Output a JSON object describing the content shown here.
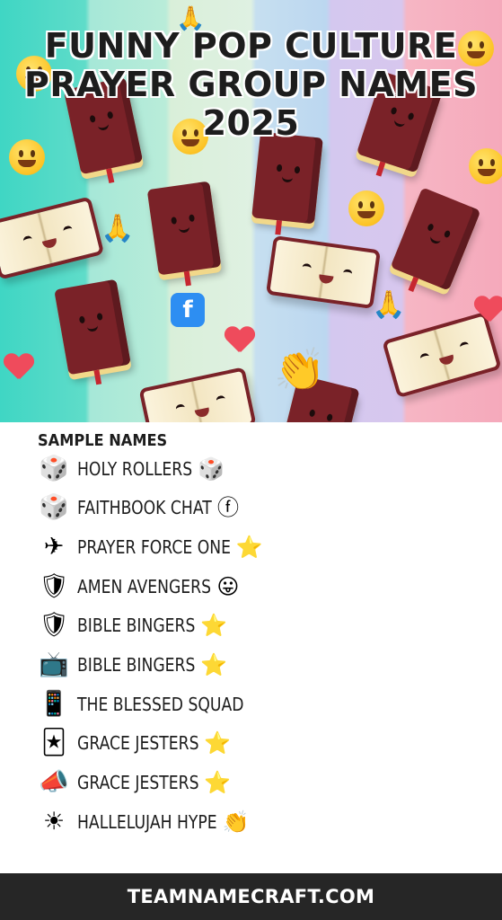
{
  "hero": {
    "title_lines": [
      "FUNNY POP CULTURE",
      "PRAYER GROUP NAMES",
      "2025"
    ],
    "colors": {
      "teal": "#3fd6c4",
      "mint": "#b9ecd9",
      "lavender": "#d7c7ee",
      "pink": "#f5a9bb",
      "bible": "#7a2228"
    },
    "decorations": [
      "bible-icon",
      "open-book-icon",
      "smiley-icon",
      "praying-hands-icon",
      "heart-icon",
      "facebook-bubble-icon",
      "clapping-hands-icon"
    ],
    "fb_letter": "f"
  },
  "list": {
    "heading": "SAMPLE NAMES",
    "items": [
      {
        "lead": "🎲",
        "lead_icon": "dice-icon",
        "label": "HOLY ROLLERS",
        "trail": "🎲",
        "trail_icon": "dice-icon"
      },
      {
        "lead": "🎲",
        "lead_icon": "gray-dice-icon",
        "label": "FAITHBOOK CHAT",
        "trail": "ⓕ",
        "trail_icon": "facebook-icon"
      },
      {
        "lead": "✈",
        "lead_icon": "airplane-icon",
        "label": "PRAYER FORCE ONE",
        "trail": "⭐",
        "trail_icon": "star-icon"
      },
      {
        "lead": "🛡",
        "lead_icon": "shield-icon",
        "label": "AMEN AVENGERS",
        "trail": "😛",
        "trail_icon": "tongue-face-icon"
      },
      {
        "lead": "🛡",
        "lead_icon": "red-shield-icon",
        "label": "BIBLE BINGERS",
        "trail": "⭐",
        "trail_icon": "star-icon"
      },
      {
        "lead": "📺",
        "lead_icon": "tv-icon",
        "label": "BIBLE BINGERS",
        "trail": "⭐",
        "trail_icon": "star-icon"
      },
      {
        "lead": "📱",
        "lead_icon": "phone-icon",
        "label": "THE BLESSED SQUAD",
        "trail": "",
        "trail_icon": ""
      },
      {
        "lead": "🃏",
        "lead_icon": "jester-hat-icon",
        "label": "GRACE JESTERS",
        "trail": "⭐",
        "trail_icon": "star-icon"
      },
      {
        "lead": "📣",
        "lead_icon": "megaphone-icon",
        "label": "GRACE JESTERS",
        "trail": "⭐",
        "trail_icon": "star-icon"
      },
      {
        "lead": "☀",
        "lead_icon": "sun-icon",
        "label": "HALLELUJAH HYPE",
        "trail": "👏",
        "trail_icon": "clapping-hands-icon"
      }
    ]
  },
  "footer": {
    "text": "TEAMNAMECRAFT.COM"
  }
}
